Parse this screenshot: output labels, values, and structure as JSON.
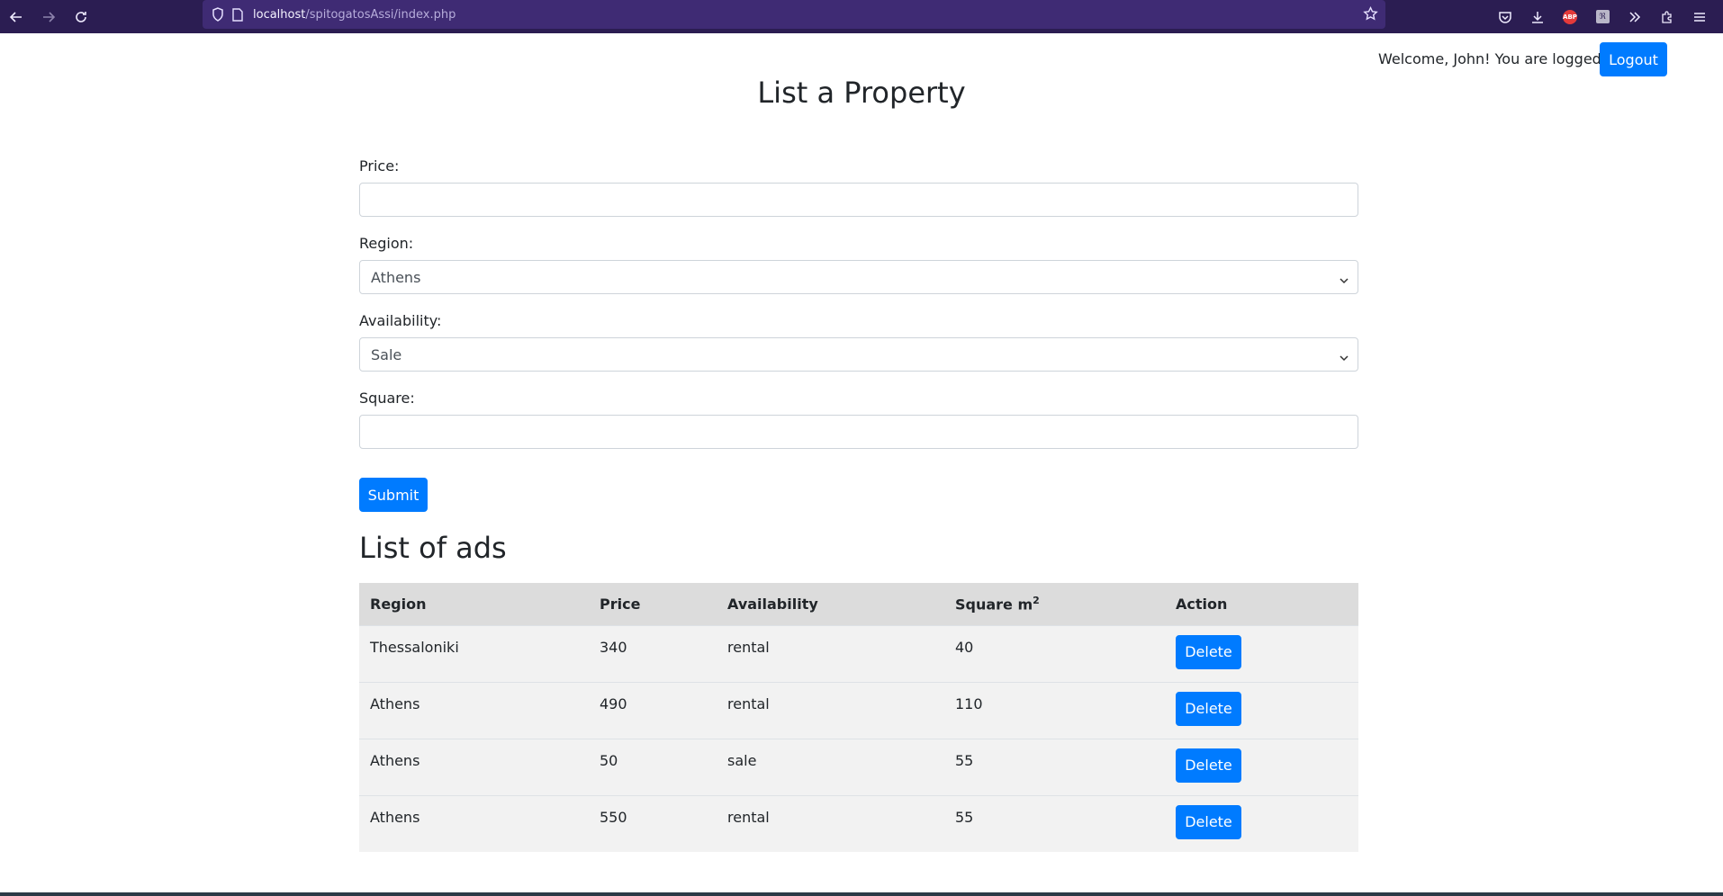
{
  "browser": {
    "url_host": "localhost",
    "url_path": "/spitogatosAssi/index.php"
  },
  "header": {
    "welcome_text": "Welcome, John! You are logged in.",
    "logout_label": "Logout"
  },
  "form": {
    "title": "List a Property",
    "price_label": "Price:",
    "price_value": "",
    "region_label": "Region:",
    "region_value": "Athens",
    "availability_label": "Availability:",
    "availability_value": "Sale",
    "square_label": "Square:",
    "square_value": "",
    "submit_label": "Submit"
  },
  "ads": {
    "title": "List of ads",
    "columns": [
      "Region",
      "Price",
      "Availability",
      "Square m",
      "Action"
    ],
    "square_unit_sup": "2",
    "rows": [
      {
        "region": "Thessaloniki",
        "price": "340",
        "availability": "rental",
        "square": "40",
        "action": "Delete"
      },
      {
        "region": "Athens",
        "price": "490",
        "availability": "rental",
        "square": "110",
        "action": "Delete"
      },
      {
        "region": "Athens",
        "price": "50",
        "availability": "sale",
        "square": "55",
        "action": "Delete"
      },
      {
        "region": "Athens",
        "price": "550",
        "availability": "rental",
        "square": "55",
        "action": "Delete"
      }
    ]
  },
  "colors": {
    "primary": "#007bff",
    "browser_toolbar": "#2b1d52",
    "table_header": "#dcdcdc",
    "table_row": "#f2f2f2"
  }
}
